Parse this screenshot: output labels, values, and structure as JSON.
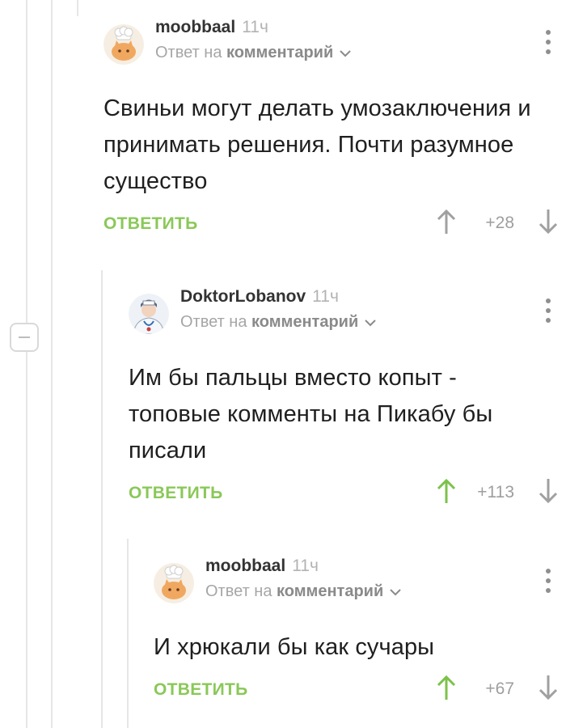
{
  "comments": [
    {
      "username": "moobbaal",
      "time": "11ч",
      "reply_prefix": "Ответ на",
      "reply_link": "комментарий",
      "text": "Свиньи могут делать умозаключения и принимать решения. Почти разумное существо",
      "reply_label": "ОТВЕТИТЬ",
      "score": "+28",
      "upvoted": false,
      "avatar_icon": "chef-cat-avatar"
    },
    {
      "username": "DoktorLobanov",
      "time": "11ч",
      "reply_prefix": "Ответ на",
      "reply_link": "комментарий",
      "text": "Им бы пальцы вместо копыт - топовые комменты на Пикабу бы писали",
      "reply_label": "ОТВЕТИТЬ",
      "score": "+113",
      "upvoted": true,
      "avatar_icon": "doctor-avatar"
    },
    {
      "username": "moobbaal",
      "time": "11ч",
      "reply_prefix": "Ответ на",
      "reply_link": "комментарий",
      "text": "И хрюкали бы как сучары",
      "reply_label": "ОТВЕТИТЬ",
      "score": "+67",
      "upvoted": true,
      "avatar_icon": "chef-cat-avatar"
    }
  ],
  "colors": {
    "accent_green": "#8ac858",
    "upvote_active": "#8ac858",
    "arrow_inactive": "#a0a0a0",
    "thread_line": "#e6e6e6"
  }
}
